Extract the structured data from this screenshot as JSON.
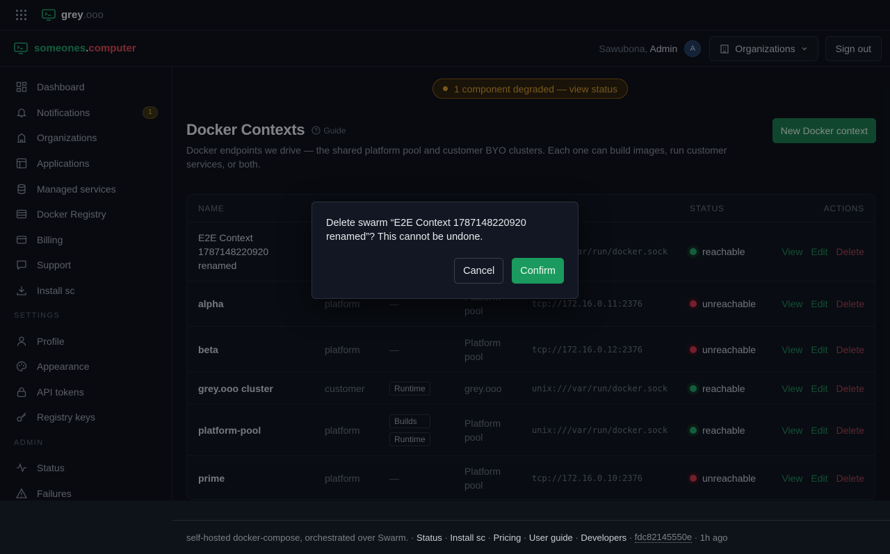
{
  "topbar": {
    "brand_main": "grey",
    "brand_dim": ".ooo"
  },
  "header": {
    "logo_green": "someones",
    "logo_dot": ".",
    "logo_red": "computer",
    "greeting": "Sawubona,",
    "user": "Admin",
    "avatar_initial": "A",
    "org_button": "Organizations",
    "signout": "Sign out"
  },
  "sidebar": {
    "items": [
      {
        "label": "Dashboard",
        "icon": "dashboard-icon"
      },
      {
        "label": "Notifications",
        "icon": "bell-icon",
        "badge": "1"
      },
      {
        "label": "Organizations",
        "icon": "building-icon"
      },
      {
        "label": "Applications",
        "icon": "layout-icon"
      },
      {
        "label": "Managed services",
        "icon": "database-icon"
      },
      {
        "label": "Docker Registry",
        "icon": "server-icon"
      },
      {
        "label": "Billing",
        "icon": "credit-card-icon"
      },
      {
        "label": "Support",
        "icon": "message-icon"
      },
      {
        "label": "Install sc",
        "icon": "download-icon"
      }
    ],
    "settings_title": "SETTINGS",
    "settings": [
      {
        "label": "Profile",
        "icon": "user-icon"
      },
      {
        "label": "Appearance",
        "icon": "palette-icon"
      },
      {
        "label": "API tokens",
        "icon": "lock-icon"
      },
      {
        "label": "Registry keys",
        "icon": "key-icon"
      }
    ],
    "admin_title": "ADMIN",
    "admin": [
      {
        "label": "Status",
        "icon": "activity-icon"
      },
      {
        "label": "Failures",
        "icon": "warning-icon"
      }
    ]
  },
  "alert": "1 component degraded — view status",
  "page": {
    "title": "Docker Contexts",
    "guide": "Guide",
    "description": "Docker endpoints we drive — the shared platform pool and customer BYO clusters. Each one can build images, run customer services, or both.",
    "new_button": "New Docker context"
  },
  "table": {
    "headers": {
      "name": "NAME",
      "status": "STATUS",
      "actions": "ACTIONS"
    },
    "actions": {
      "view": "View",
      "edit": "Edit",
      "delete": "Delete"
    },
    "rows": [
      {
        "name": "E2E Context 1787148220920 renamed",
        "kind": "",
        "roles": [],
        "location": "",
        "host": "unix:///var/run/docker.sock",
        "status": "reachable",
        "ok": true
      },
      {
        "name": "alpha",
        "kind": "platform",
        "roles": [],
        "roles_empty": "—",
        "location": "Platform pool",
        "host": "tcp://172.16.0.11:2376",
        "status": "unreachable",
        "ok": false
      },
      {
        "name": "beta",
        "kind": "platform",
        "roles": [],
        "roles_empty": "—",
        "location": "Platform pool",
        "host": "tcp://172.16.0.12:2376",
        "status": "unreachable",
        "ok": false
      },
      {
        "name": "grey.ooo cluster",
        "kind": "customer",
        "roles": [
          "Runtime"
        ],
        "location": "grey.ooo",
        "host": "unix:///var/run/docker.sock",
        "status": "reachable",
        "ok": true
      },
      {
        "name": "platform-pool",
        "kind": "platform",
        "roles": [
          "Builds",
          "Runtime"
        ],
        "location": "Platform pool",
        "host": "unix:///var/run/docker.sock",
        "status": "reachable",
        "ok": true
      },
      {
        "name": "prime",
        "kind": "platform",
        "roles": [],
        "roles_empty": "—",
        "location": "Platform pool",
        "host": "tcp://172.16.0.10:2376",
        "status": "unreachable",
        "ok": false
      }
    ]
  },
  "footer": {
    "text": "self-hosted docker-compose, orchestrated over Swarm.",
    "sep": "·",
    "links": [
      "Status",
      "Install sc",
      "Pricing",
      "User guide",
      "Developers"
    ],
    "hash": "fdc82145550e",
    "age": "1h ago"
  },
  "modal": {
    "message": "Delete swarm “E2E Context 1787148220920 renamed”? This cannot be undone.",
    "cancel": "Cancel",
    "confirm": "Confirm"
  },
  "colors": {
    "accent": "#1a9a5e",
    "danger": "#d0344a",
    "warning": "#d99a2b"
  }
}
